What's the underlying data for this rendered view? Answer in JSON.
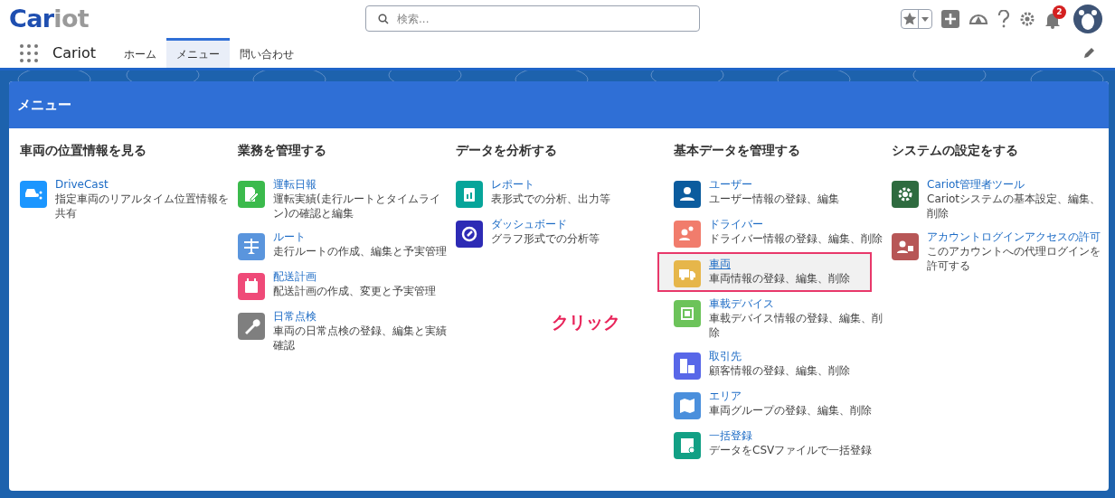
{
  "header": {
    "logo_parts": [
      "Car",
      "iot"
    ],
    "search": {
      "placeholder": "検索..."
    },
    "notification_count": "2"
  },
  "nav": {
    "app_name": "Cariot",
    "tabs": [
      {
        "label": "ホーム",
        "selected": false
      },
      {
        "label": "メニュー",
        "selected": true
      },
      {
        "label": "問い合わせ",
        "selected": false
      }
    ]
  },
  "menu": {
    "title": "メニュー",
    "columns": [
      {
        "heading": "車両の位置情報を見る",
        "items": [
          {
            "kind": "car",
            "color": "#1b96ff",
            "title": "DriveCast",
            "description": "指定車両のリアルタイム位置情報を共有",
            "selected": false
          }
        ]
      },
      {
        "heading": "業務を管理する",
        "items": [
          {
            "kind": "edit",
            "color": "#3bba4c",
            "title": "運転日報",
            "description": "運転実績(走行ルートとタイムライン)の確認と編集",
            "selected": false
          },
          {
            "kind": "route",
            "color": "#5a95dd",
            "title": "ルート",
            "description": "走行ルートの作成、編集と予実管理",
            "selected": false
          },
          {
            "kind": "calendar",
            "color": "#ef4a78",
            "title": "配送計画",
            "description": "配送計画の作成、変更と予実管理",
            "selected": false
          },
          {
            "kind": "wrench",
            "color": "#7f7f7f",
            "title": "日常点検",
            "description": "車両の日常点検の登録、編集と実績確認",
            "selected": false
          }
        ]
      },
      {
        "heading": "データを分析する",
        "items": [
          {
            "kind": "report",
            "color": "#06a59a",
            "title": "レポート",
            "description": "表形式での分析、出力等",
            "selected": false
          },
          {
            "kind": "gauge",
            "color": "#2d2bb5",
            "title": "ダッシュボード",
            "description": "グラフ形式での分析等",
            "selected": false
          }
        ]
      },
      {
        "heading": "基本データを管理する",
        "items": [
          {
            "kind": "user",
            "color": "#0b5c9e",
            "title": "ユーザー",
            "description": "ユーザー情報の登録、編集",
            "selected": false
          },
          {
            "kind": "users",
            "color": "#f17c6c",
            "title": "ドライバー",
            "description": "ドライバー情報の登録、編集、削除",
            "selected": false
          },
          {
            "kind": "truck",
            "color": "#e6b64a",
            "title": "車両",
            "description": "車両情報の登録、編集、削除",
            "selected": true
          },
          {
            "kind": "chip",
            "color": "#6cc35a",
            "title": "車載デバイス",
            "description": "車載デバイス情報の登録、編集、削除",
            "selected": false
          },
          {
            "kind": "building",
            "color": "#5867e8",
            "title": "取引先",
            "description": "顧客情報の登録、編集、削除",
            "selected": false
          },
          {
            "kind": "map",
            "color": "#4a8fdc",
            "title": "エリア",
            "description": "車両グループの登録、編集、削除",
            "selected": false
          },
          {
            "kind": "table",
            "color": "#12a085",
            "title": "一括登録",
            "description": "データをCSVファイルで一括登録",
            "selected": false
          }
        ]
      },
      {
        "heading": "システムの設定をする",
        "items": [
          {
            "kind": "gear",
            "color": "#2e6b3f",
            "title": "Cariot管理者ツール",
            "description": "Cariotシステムの基本設定、編集、削除",
            "selected": false
          },
          {
            "kind": "userlock",
            "color": "#b75656",
            "title": "アカウントログインアクセスの許可",
            "description": "このアカウントへの代理ログインを許可する",
            "selected": false
          }
        ]
      }
    ]
  },
  "annotation": {
    "text": "クリック"
  }
}
